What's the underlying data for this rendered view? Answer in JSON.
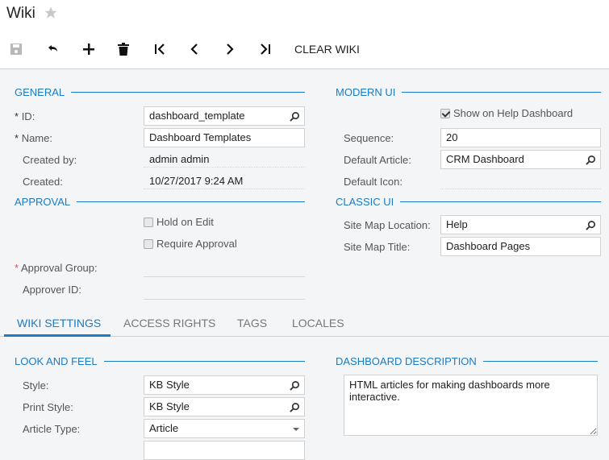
{
  "header": {
    "title": "Wiki",
    "favorite_icon": "star-icon"
  },
  "toolbar": {
    "buttons": [
      {
        "name": "save",
        "icon": "save-icon",
        "enabled": false
      },
      {
        "name": "undo",
        "icon": "undo-icon",
        "enabled": true
      },
      {
        "name": "add",
        "icon": "plus-icon",
        "enabled": true
      },
      {
        "name": "delete",
        "icon": "trash-icon",
        "enabled": true
      },
      {
        "name": "first",
        "icon": "first-record-icon",
        "enabled": true
      },
      {
        "name": "previous",
        "icon": "previous-icon",
        "enabled": true
      },
      {
        "name": "next",
        "icon": "next-icon",
        "enabled": true
      },
      {
        "name": "last",
        "icon": "last-record-icon",
        "enabled": true
      }
    ],
    "clear_wiki_label": "CLEAR WIKI"
  },
  "general": {
    "heading": "GENERAL",
    "id_label": "ID:",
    "id_value": "dashboard_template",
    "name_label": "Name:",
    "name_value": "Dashboard Templates",
    "created_by_label": "Created by:",
    "created_by_value": "admin admin",
    "created_label": "Created:",
    "created_value": "10/27/2017 9:24 AM",
    "required_mark": "*"
  },
  "approval": {
    "heading": "APPROVAL",
    "hold_on_edit_label": "Hold on Edit",
    "hold_on_edit_checked": false,
    "require_approval_label": "Require Approval",
    "require_approval_checked": false,
    "approval_group_label": "Approval Group:",
    "approval_group_value": "",
    "approver_id_label": "Approver ID:",
    "approver_id_value": "",
    "required_mark": "*"
  },
  "modern_ui": {
    "heading": "MODERN UI",
    "show_on_help_dashboard_label": "Show on Help Dashboard",
    "show_on_help_dashboard_checked": true,
    "sequence_label": "Sequence:",
    "sequence_value": "20",
    "default_article_label": "Default Article:",
    "default_article_value": "CRM Dashboard",
    "default_icon_label": "Default Icon:",
    "default_icon_value": ""
  },
  "classic_ui": {
    "heading": "CLASSIC UI",
    "site_map_location_label": "Site Map Location:",
    "site_map_location_value": "Help",
    "site_map_title_label": "Site Map Title:",
    "site_map_title_value": "Dashboard Pages"
  },
  "tabs": [
    {
      "label": "WIKI SETTINGS",
      "active": true
    },
    {
      "label": "ACCESS RIGHTS",
      "active": false
    },
    {
      "label": "TAGS",
      "active": false
    },
    {
      "label": "LOCALES",
      "active": false
    }
  ],
  "look_and_feel": {
    "heading": "LOOK AND FEEL",
    "style_label": "Style:",
    "style_value": "KB Style",
    "print_style_label": "Print Style:",
    "print_style_value": "KB Style",
    "article_type_label": "Article Type:",
    "article_type_value": "Article"
  },
  "dashboard_description": {
    "heading": "DASHBOARD DESCRIPTION",
    "value": "HTML articles for making dashboards more interactive."
  },
  "colors": {
    "accent": "#1a7bc6",
    "background": "#f4f5f7",
    "label": "#555555",
    "required_red": "#d9534f"
  }
}
